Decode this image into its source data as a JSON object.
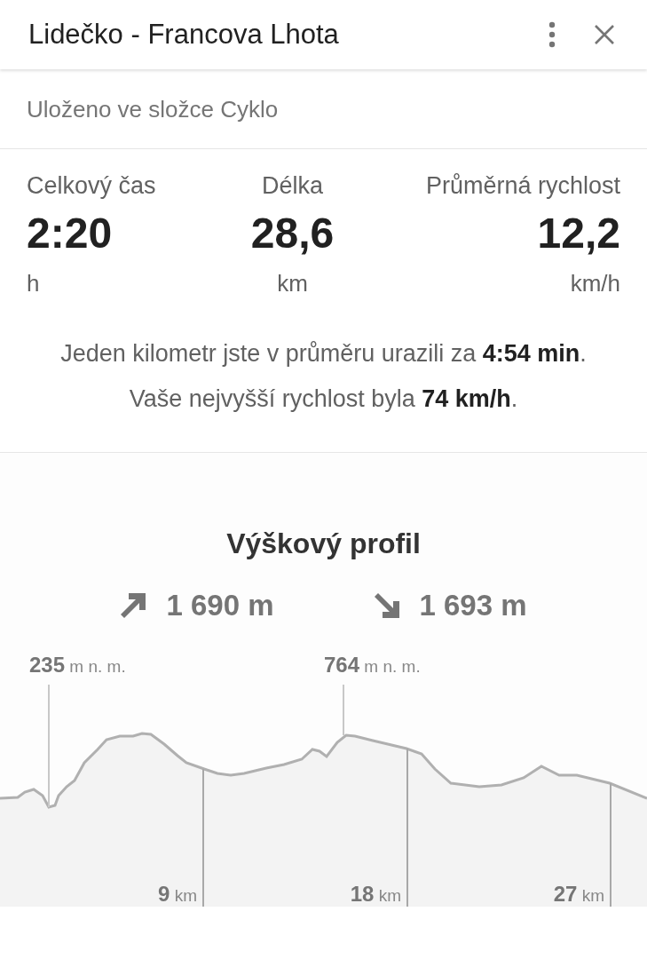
{
  "header": {
    "title": "Lidečko - Francova Lhota"
  },
  "folder": "Uloženo ve složce Cyklo",
  "stats": [
    {
      "label": "Celkový čas",
      "value": "2:20",
      "unit": "h"
    },
    {
      "label": "Délka",
      "value": "28,6",
      "unit": "km"
    },
    {
      "label": "Průměrná rychlost",
      "value": "12,2",
      "unit": "km/h"
    }
  ],
  "summary": [
    "Jeden kilometr jste v průměru urazili za **4:54 min**.",
    "Vaše nejvyšší rychlost byla **74 km/h**."
  ],
  "elevation": {
    "title": "Výškový profil",
    "totals": [
      {
        "kind": "ascent",
        "value": "1 690 m"
      },
      {
        "kind": "descent",
        "value": "1 693 m"
      }
    ],
    "markers": [
      "**235** m n. m.",
      "**764** m n. m."
    ],
    "distance_ticks": [
      "**9** km",
      "**18** km",
      "**27** km"
    ]
  }
}
